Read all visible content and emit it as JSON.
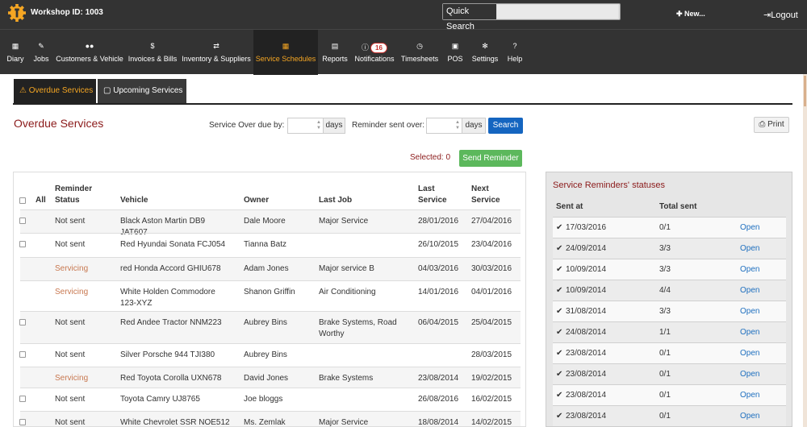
{
  "topbar": {
    "workshop_id": "Workshop ID: 1003",
    "quick_search_label": "Quick Search",
    "quick_search_value": "",
    "new_label": "New...",
    "logout_label": "Logout"
  },
  "nav": [
    {
      "label": "Diary",
      "icon": "calendar-icon"
    },
    {
      "label": "Jobs",
      "icon": "wrench-icon"
    },
    {
      "label": "Customers & Vehicle",
      "icon": "users-icon"
    },
    {
      "label": "Invoices & Bills",
      "icon": "dollar-icon"
    },
    {
      "label": "Inventory & Suppliers",
      "icon": "exchange-icon"
    },
    {
      "label": "Service Schedules",
      "icon": "calendar-icon"
    },
    {
      "label": "Reports",
      "icon": "chart-icon"
    },
    {
      "label": "Notifications",
      "icon": "info-icon",
      "badge": "16"
    },
    {
      "label": "Timesheets",
      "icon": "clock-icon"
    },
    {
      "label": "POS",
      "icon": "pos-icon"
    },
    {
      "label": "Settings",
      "icon": "gears-icon"
    },
    {
      "label": "Help",
      "icon": "question-icon"
    }
  ],
  "active_nav": "Service Schedules",
  "tabs": {
    "overdue": "Overdue Services",
    "upcoming": "Upcoming Services"
  },
  "page_title": "Overdue Services",
  "filters": {
    "overdue_label": "Service Over due by:",
    "overdue_value": "",
    "days1": "days",
    "reminder_label": "Reminder sent over:",
    "reminder_value": "",
    "days2": "days",
    "search": "Search"
  },
  "print": "Print",
  "selected": "Selected: 0",
  "send_reminder": "Send Reminder",
  "table": {
    "headers": {
      "all": "All",
      "status": "Reminder Status",
      "vehicle": "Vehicle",
      "owner": "Owner",
      "last_job": "Last Job",
      "last_service": "Last Service",
      "next_service": "Next Service"
    },
    "rows": [
      {
        "checkbox": true,
        "status": "Not sent",
        "vehicle": "Black Aston Martin DB9 JAT607",
        "owner": "Dale Moore",
        "last_job": "Major Service",
        "last_service": "28/01/2016",
        "next_service": "27/04/2016"
      },
      {
        "checkbox": true,
        "status": "Not sent",
        "vehicle": "Red Hyundai Sonata FCJ054",
        "owner": "Tianna Batz",
        "last_job": "",
        "last_service": "26/10/2015",
        "next_service": "23/04/2016"
      },
      {
        "checkbox": false,
        "status": "Servicing",
        "vehicle": "red Honda Accord GHIU678",
        "owner": "Adam Jones",
        "last_job": "Major service B",
        "last_service": "04/03/2016",
        "next_service": "30/03/2016"
      },
      {
        "checkbox": false,
        "status": "Servicing",
        "vehicle": "White Holden Commodore 123-XYZ",
        "owner": "Shanon Griffin",
        "last_job": "Air Conditioning",
        "last_service": "14/01/2016",
        "next_service": "04/01/2016"
      },
      {
        "checkbox": true,
        "status": "Not sent",
        "vehicle": "Red Andee Tractor NNM223",
        "owner": "Aubrey Bins",
        "last_job": "Brake Systems, Road Worthy",
        "last_service": "06/04/2015",
        "next_service": "25/04/2015"
      },
      {
        "checkbox": true,
        "status": "Not sent",
        "vehicle": "Silver Porsche 944 TJI380",
        "owner": "Aubrey Bins",
        "last_job": "",
        "last_service": "",
        "next_service": "28/03/2015"
      },
      {
        "checkbox": false,
        "status": "Servicing",
        "vehicle": "Red Toyota Corolla UXN678",
        "owner": "David Jones",
        "last_job": "Brake Systems",
        "last_service": "23/08/2014",
        "next_service": "19/02/2015"
      },
      {
        "checkbox": true,
        "status": "Not sent",
        "vehicle": "Toyota Camry UJ8765",
        "owner": "Joe bloggs",
        "last_job": "",
        "last_service": "26/08/2016",
        "next_service": "16/02/2015"
      },
      {
        "checkbox": true,
        "status": "Not sent",
        "vehicle": "White Chevrolet SSR NOE512",
        "owner": "Ms. Zemlak",
        "last_job": "Major Service",
        "last_service": "18/08/2014",
        "next_service": "14/02/2015"
      }
    ]
  },
  "reminders": {
    "title": "Service Reminders' statuses",
    "headers": {
      "sent_at": "Sent at",
      "total_sent": "Total sent"
    },
    "rows": [
      {
        "sent_at": "17/03/2016",
        "total": "0/1",
        "action": "Open"
      },
      {
        "sent_at": "24/09/2014",
        "total": "3/3",
        "action": "Open"
      },
      {
        "sent_at": "10/09/2014",
        "total": "3/3",
        "action": "Open"
      },
      {
        "sent_at": "10/09/2014",
        "total": "4/4",
        "action": "Open"
      },
      {
        "sent_at": "31/08/2014",
        "total": "3/3",
        "action": "Open"
      },
      {
        "sent_at": "24/08/2014",
        "total": "1/1",
        "action": "Open"
      },
      {
        "sent_at": "23/08/2014",
        "total": "0/1",
        "action": "Open"
      },
      {
        "sent_at": "23/08/2014",
        "total": "0/1",
        "action": "Open"
      },
      {
        "sent_at": "23/08/2014",
        "total": "0/1",
        "action": "Open"
      },
      {
        "sent_at": "23/08/2014",
        "total": "0/1",
        "action": "Open"
      }
    ]
  },
  "colors": {
    "accent": "#f5a623",
    "title_red": "#8b1a1a",
    "servicing": "#c87850",
    "search_blue": "#1565c0",
    "send_green": "#5cb85c"
  }
}
